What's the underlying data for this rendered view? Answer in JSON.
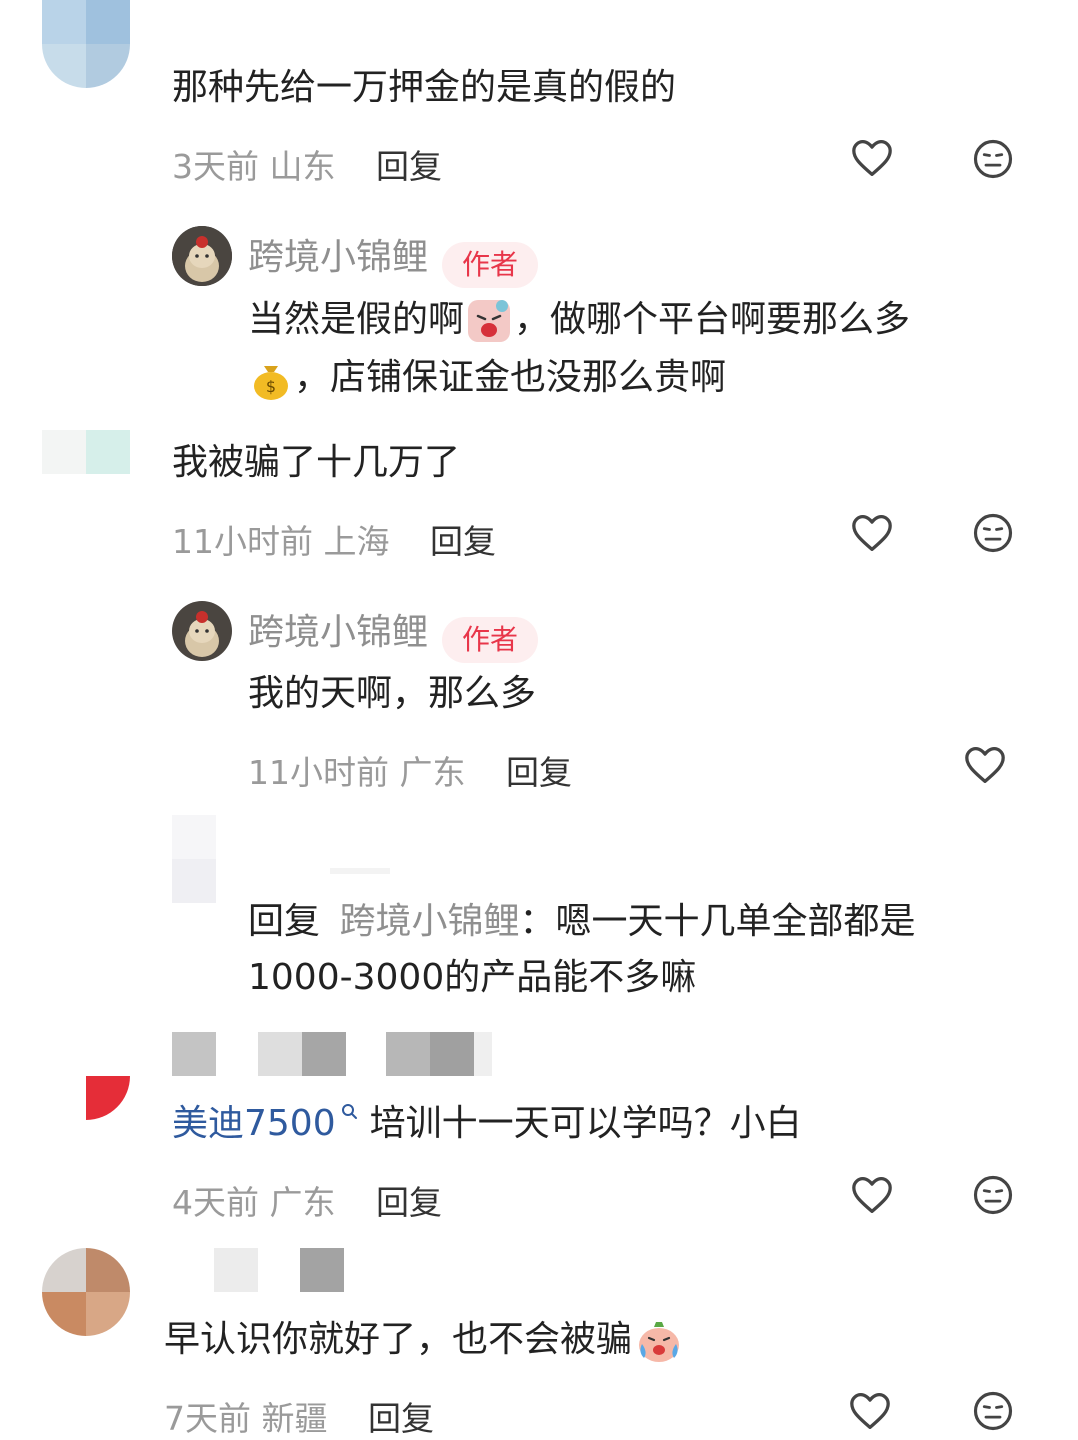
{
  "comments": [
    {
      "text": "那种先给一万押金的是真的假的",
      "meta": {
        "time": "3天前",
        "location": "山东",
        "reply": "回复"
      },
      "author_reply": {
        "name": "跨境小锦鲤",
        "badge": "作者",
        "line1": "当然是假的啊",
        "line1b": "，做哪个平台啊要那么多",
        "line2": "，店铺保证金也没那么贵啊"
      }
    },
    {
      "text": "我被骗了十几万了",
      "meta": {
        "time": "11小时前",
        "location": "上海",
        "reply": "回复"
      },
      "author_reply": {
        "name": "跨境小锦鲤",
        "badge": "作者",
        "text": "我的天啊，那么多",
        "meta": {
          "time": "11小时前",
          "location": "广东",
          "reply": "回复"
        }
      },
      "sub_reply": {
        "prefix": "回复",
        "target": "跨境小锦鲤",
        "line1": "：嗯一天十几单全部都是",
        "line2": "1000-3000的产品能不多嘛"
      }
    },
    {
      "mention": "美迪7500",
      "mention_icon": "search-icon",
      "text": "培训十一天可以学吗？小白",
      "meta": {
        "time": "4天前",
        "location": "广东",
        "reply": "回复"
      }
    },
    {
      "text": "早认识你就好了，也不会被骗",
      "meta": {
        "time": "7天前",
        "location": "新疆",
        "reply": "回复"
      }
    }
  ],
  "icons": {
    "like": "heart-icon",
    "dislike": "neutral-face-icon"
  },
  "colors": {
    "badge_bg": "#fdeeef",
    "badge_text": "#e8364a",
    "mention": "#2f5a9e"
  }
}
